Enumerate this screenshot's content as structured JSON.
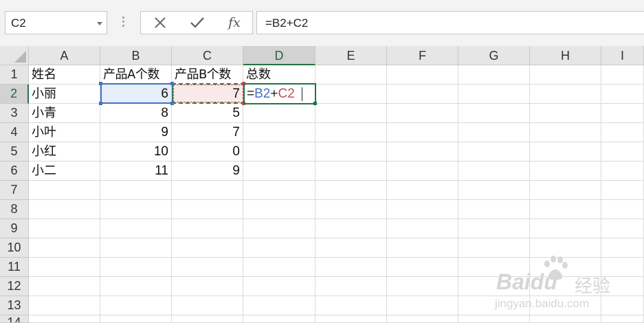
{
  "formula_bar": {
    "name_box": "C2",
    "cancel_icon": "close-icon",
    "enter_icon": "check-icon",
    "fx_label": "fx",
    "formula": "=B2+C2"
  },
  "columns": [
    "A",
    "B",
    "C",
    "D",
    "E",
    "F",
    "G",
    "H",
    "I"
  ],
  "rows": [
    "1",
    "2",
    "3",
    "4",
    "5",
    "6",
    "7",
    "8",
    "9",
    "10",
    "11",
    "12",
    "13",
    "14"
  ],
  "cells": {
    "A1": "姓名",
    "B1": "产品A个数",
    "C1": "产品B个数",
    "D1": "总数",
    "A2": "小丽",
    "B2": "6",
    "C2": "7",
    "A3": "小青",
    "B3": "8",
    "C3": "5",
    "A4": "小叶",
    "B4": "9",
    "C4": "7",
    "A5": "小红",
    "B5": "10",
    "C5": "0",
    "A6": "小二",
    "B6": "11",
    "C6": "9"
  },
  "editing": {
    "cell": "D2",
    "prefix": "=",
    "ref1": "B2",
    "operator": "+",
    "ref2": "C2",
    "ref1_color": "#4472c4",
    "ref2_color": "#c0504d"
  },
  "accent_color": "#217346",
  "watermark": {
    "brand": "Baidu",
    "brand_cn": "经验",
    "url": "jingyan.baidu.com"
  }
}
